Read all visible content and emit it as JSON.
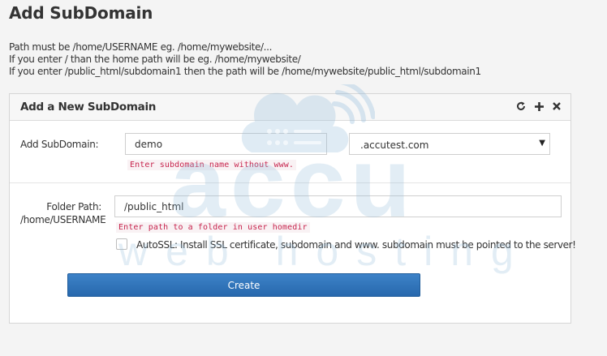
{
  "page": {
    "title": "Add SubDomain",
    "help_lines": [
      "Path must be /home/USERNAME eg. /home/mywebsite/...",
      "If you enter / than the home path will be eg. /home/mywebsite/",
      "If you enter /public_html/subdomain1 then the path will be /home/mywebsite/public_html/subdomain1"
    ]
  },
  "panel": {
    "title": "Add a New SubDomain",
    "tools": [
      "refresh-icon",
      "plus-icon",
      "close-icon"
    ]
  },
  "form": {
    "subdomain": {
      "label": "Add SubDomain:",
      "value": "demo",
      "hint": "Enter subdomain name without www."
    },
    "domain_select": {
      "value": ".accutest.com",
      "caret": "▼"
    },
    "folder": {
      "label_line1": "Folder Path:",
      "label_line2": "/home/USERNAME",
      "value": "/public_html",
      "hint": "Enter path to a folder in user homedir"
    },
    "autossl": {
      "checked": false,
      "label": "AutoSSL: Install SSL certificate, subdomain and www. subdomain must be pointed to the server!"
    },
    "submit_label": "Create"
  },
  "watermark": {
    "logo_text": "accu",
    "sub_text": "web hosting",
    "color": "#96bedc"
  }
}
